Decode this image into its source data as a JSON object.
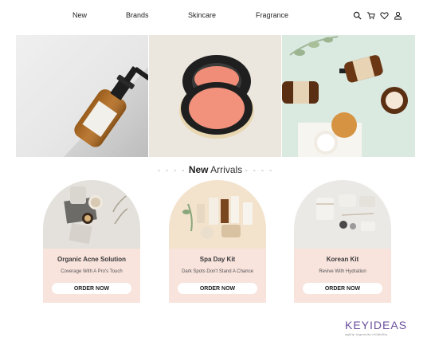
{
  "nav": {
    "links": [
      "New",
      "Brands",
      "Skincare",
      "Fragrance"
    ],
    "icons": [
      "search-icon",
      "cart-icon",
      "heart-icon",
      "user-icon"
    ]
  },
  "hero": {
    "panels": [
      "dropper-bottle-photo",
      "compact-blush-photo",
      "skincare-flatlay-photo"
    ]
  },
  "arrivals": {
    "prefix": "New",
    "suffix": "Arrivals"
  },
  "cards": [
    {
      "title": "Organic Acne Solution",
      "subtitle": "Coverage With A Pro's Touch",
      "button": "ORDER NOW"
    },
    {
      "title": "Spa Day Kit",
      "subtitle": "Dark Spots Don't Stand A Chance",
      "button": "ORDER NOW"
    },
    {
      "title": "Korean Kit",
      "subtitle": "Revive With Hydration",
      "button": "ORDER NOW"
    }
  ],
  "logo": {
    "word": "KEYIDEAS",
    "tagline": "agility·ingenuity·reliability"
  },
  "colors": {
    "card_body": "#f8e3dd",
    "logo": "#6b4f9e"
  }
}
